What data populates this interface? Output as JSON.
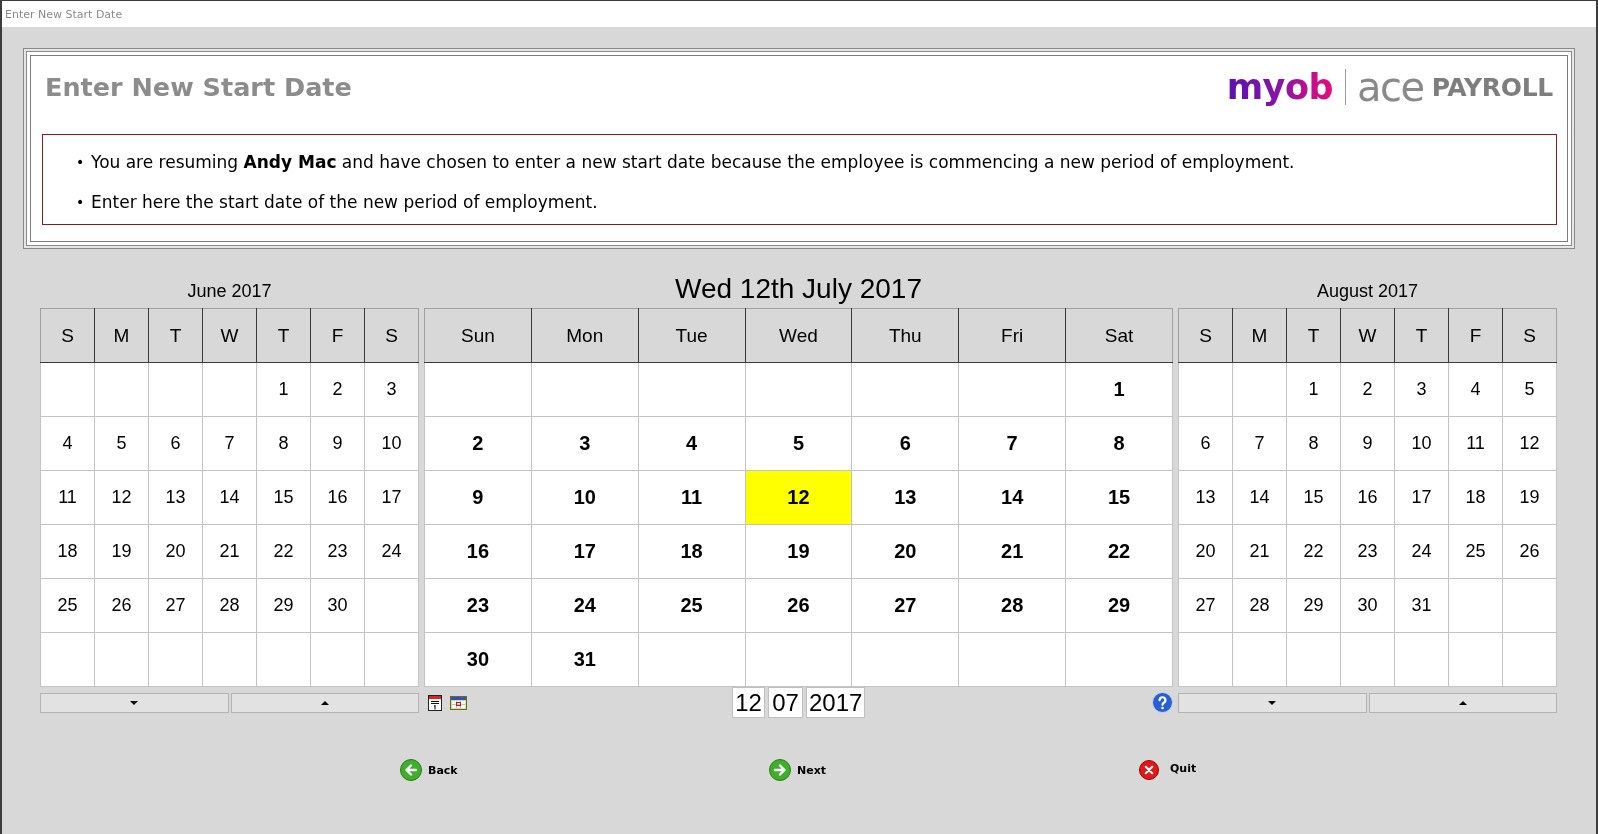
{
  "window": {
    "title": "Enter New Start Date"
  },
  "header": {
    "title": "Enter New Start Date",
    "logo": {
      "brand": "myob",
      "product": "ace",
      "edition": "PAYROLL"
    }
  },
  "info": [
    {
      "bullet": "•",
      "text": "You are resuming **Andy Mac** and have chosen to enter a new start date because the employee is commencing a new period of employment."
    },
    {
      "bullet": "•",
      "text": "Enter here the start date of the new period of employment."
    }
  ],
  "calendars": [
    {
      "kind": "side",
      "title": "June 2017",
      "weekdays": [
        "S",
        "M",
        "T",
        "W",
        "T",
        "F",
        "S"
      ],
      "weeks": [
        [
          "1",
          "2",
          "3"
        ],
        [
          "4",
          "5",
          "6",
          "7",
          "8",
          "9",
          "10"
        ],
        [
          "11",
          "12",
          "13",
          "14",
          "15",
          "16",
          "17"
        ],
        [
          "18",
          "19",
          "20",
          "21",
          "22",
          "23",
          "24"
        ],
        [
          "25",
          "26",
          "27",
          "28",
          "29",
          "30"
        ]
      ]
    },
    {
      "kind": "main",
      "title": "Wed 12th July 2017",
      "weekdays": [
        "Sun",
        "Mon",
        "Tue",
        "Wed",
        "Thu",
        "Fri",
        "Sat"
      ],
      "weeks": [
        [
          {
            "day": "1",
            "selected": false
          }
        ],
        [
          {
            "day": "2",
            "selected": false
          },
          {
            "day": "3",
            "selected": false
          },
          {
            "day": "4",
            "selected": false
          },
          {
            "day": "5",
            "selected": false
          },
          {
            "day": "6",
            "selected": false
          },
          {
            "day": "7",
            "selected": false
          },
          {
            "day": "8",
            "selected": false
          }
        ],
        [
          {
            "day": "9",
            "selected": false
          },
          {
            "day": "10",
            "selected": false
          },
          {
            "day": "11",
            "selected": false
          },
          {
            "day": "12",
            "selected": true
          },
          {
            "day": "13",
            "selected": false
          },
          {
            "day": "14",
            "selected": false
          },
          {
            "day": "15",
            "selected": false
          }
        ],
        [
          {
            "day": "16",
            "selected": false
          },
          {
            "day": "17",
            "selected": false
          },
          {
            "day": "18",
            "selected": false
          },
          {
            "day": "19",
            "selected": false
          },
          {
            "day": "20",
            "selected": false
          },
          {
            "day": "21",
            "selected": false
          },
          {
            "day": "22",
            "selected": false
          }
        ],
        [
          {
            "day": "23",
            "selected": false
          },
          {
            "day": "24",
            "selected": false
          },
          {
            "day": "25",
            "selected": false
          },
          {
            "day": "26",
            "selected": false
          },
          {
            "day": "27",
            "selected": false
          },
          {
            "day": "28",
            "selected": false
          },
          {
            "day": "29",
            "selected": false
          }
        ],
        [
          {
            "day": "30",
            "selected": false
          },
          {
            "day": "31",
            "selected": false
          }
        ]
      ]
    },
    {
      "kind": "side",
      "title": "August 2017",
      "weekdays": [
        "S",
        "M",
        "T",
        "W",
        "T",
        "F",
        "S"
      ],
      "weeks": [
        [
          "1",
          "2",
          "3",
          "4",
          "5"
        ],
        [
          "6",
          "7",
          "8",
          "9",
          "10",
          "11",
          "12"
        ],
        [
          "13",
          "14",
          "15",
          "16",
          "17",
          "18",
          "19"
        ],
        [
          "20",
          "21",
          "22",
          "23",
          "24",
          "25",
          "26"
        ],
        [
          "27",
          "28",
          "29",
          "30",
          "31"
        ]
      ]
    }
  ],
  "date_fields": [
    {
      "kind": "day",
      "value": "12"
    },
    {
      "kind": "month",
      "value": "07"
    },
    {
      "kind": "year",
      "value": "2017"
    }
  ],
  "actions": [
    {
      "kind": "back",
      "label": "Back"
    },
    {
      "kind": "next",
      "label": "Next"
    },
    {
      "kind": "quit",
      "label": "Quit"
    }
  ]
}
